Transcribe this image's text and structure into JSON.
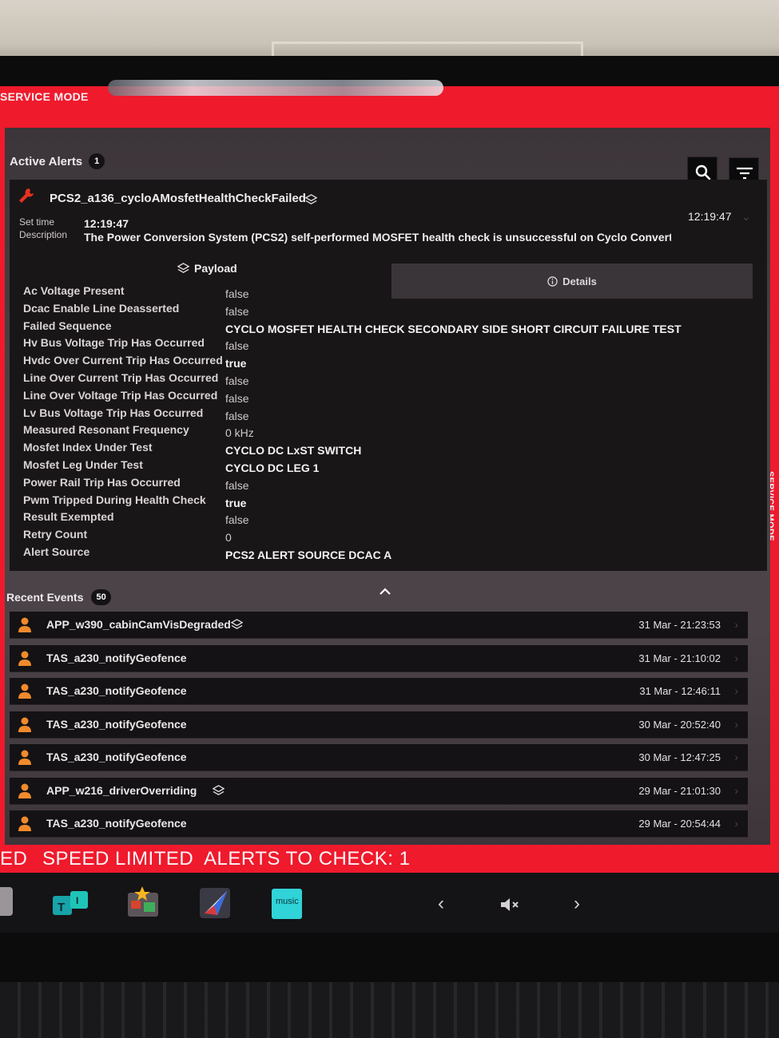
{
  "service_mode_label": "SERVICE MODE",
  "active_alerts": {
    "title": "Active Alerts",
    "count": "1",
    "search_icon": "search-icon",
    "filter_icon": "filter-icon",
    "alert": {
      "icon": "wrench-icon",
      "name": "PCS2_a136_cycloAMosfetHealthCheckFailed",
      "set_time_label": "Set time",
      "set_time": "12:19:47",
      "description_label": "Description",
      "description": "The Power Conversion System (PCS2) self-performed MOSFET health check is unsuccessful on Cyclo Converter A",
      "time_right": "12:19:47"
    },
    "tabs": {
      "payload": "Payload",
      "details": "Details"
    },
    "payload": [
      {
        "key": "Ac Voltage Present",
        "value": "false",
        "emphasis": false
      },
      {
        "key": "Dcac Enable Line Deasserted",
        "value": "false",
        "emphasis": false
      },
      {
        "key": "Failed Sequence",
        "value": "CYCLO MOSFET HEALTH CHECK SECONDARY SIDE SHORT CIRCUIT FAILURE TEST",
        "emphasis": true
      },
      {
        "key": "Hv Bus Voltage Trip Has Occurred",
        "value": "false",
        "emphasis": false
      },
      {
        "key": "Hvdc Over Current Trip Has Occurred",
        "value": "true",
        "emphasis": true
      },
      {
        "key": "Line Over Current Trip Has Occurred",
        "value": "false",
        "emphasis": false
      },
      {
        "key": "Line Over Voltage Trip Has Occurred",
        "value": "false",
        "emphasis": false
      },
      {
        "key": "Lv Bus Voltage Trip Has Occurred",
        "value": "false",
        "emphasis": false
      },
      {
        "key": "Measured Resonant Frequency",
        "value": "0 kHz",
        "emphasis": false
      },
      {
        "key": "Mosfet Index Under Test",
        "value": "CYCLO DC LxST SWITCH",
        "emphasis": true
      },
      {
        "key": "Mosfet Leg Under Test",
        "value": "CYCLO DC LEG 1",
        "emphasis": true
      },
      {
        "key": "Power Rail Trip Has Occurred",
        "value": "false",
        "emphasis": false
      },
      {
        "key": "Pwm Tripped During Health Check",
        "value": "true",
        "emphasis": true
      },
      {
        "key": "Result Exempted",
        "value": "false",
        "emphasis": false
      },
      {
        "key": "Retry Count",
        "value": "0",
        "emphasis": false
      },
      {
        "key": "Alert Source",
        "value": "PCS2 ALERT SOURCE DCAC A",
        "emphasis": true
      }
    ]
  },
  "recent_events": {
    "title": "Recent Events",
    "count": "50",
    "items": [
      {
        "name": "APP_w390_cabinCamVisDegraded",
        "time": "31 Mar - 21:23:53",
        "has_payload": true
      },
      {
        "name": "TAS_a230_notifyGeofence",
        "time": "31 Mar - 21:10:02",
        "has_payload": false
      },
      {
        "name": "TAS_a230_notifyGeofence",
        "time": "31 Mar - 12:46:11",
        "has_payload": false
      },
      {
        "name": "TAS_a230_notifyGeofence",
        "time": "30 Mar - 20:52:40",
        "has_payload": false
      },
      {
        "name": "TAS_a230_notifyGeofence",
        "time": "30 Mar - 12:47:25",
        "has_payload": false
      },
      {
        "name": "APP_w216_driverOverriding",
        "time": "29 Mar - 21:01:30",
        "has_payload": true
      },
      {
        "name": "TAS_a230_notifyGeofence",
        "time": "29 Mar - 20:54:44",
        "has_payload": false
      }
    ]
  },
  "status_bar": {
    "left_fragment": "ED",
    "speed_limited": "SPEED LIMITED",
    "alerts_to_check": "ALERTS TO CHECK: 1"
  },
  "dock": {
    "apps": [
      "toybox-app-icon",
      "arcade-app-icon",
      "navigation-app-icon",
      "amazon-music-icon"
    ],
    "music_label": "music",
    "volume_icon": "volume-muted-icon"
  },
  "colors": {
    "service_red": "#ef1a2c",
    "panel": "#4a4246",
    "card": "#191618",
    "row": "#141214",
    "warning_red": "#e8321f",
    "person_orange": "#f08a2c"
  }
}
